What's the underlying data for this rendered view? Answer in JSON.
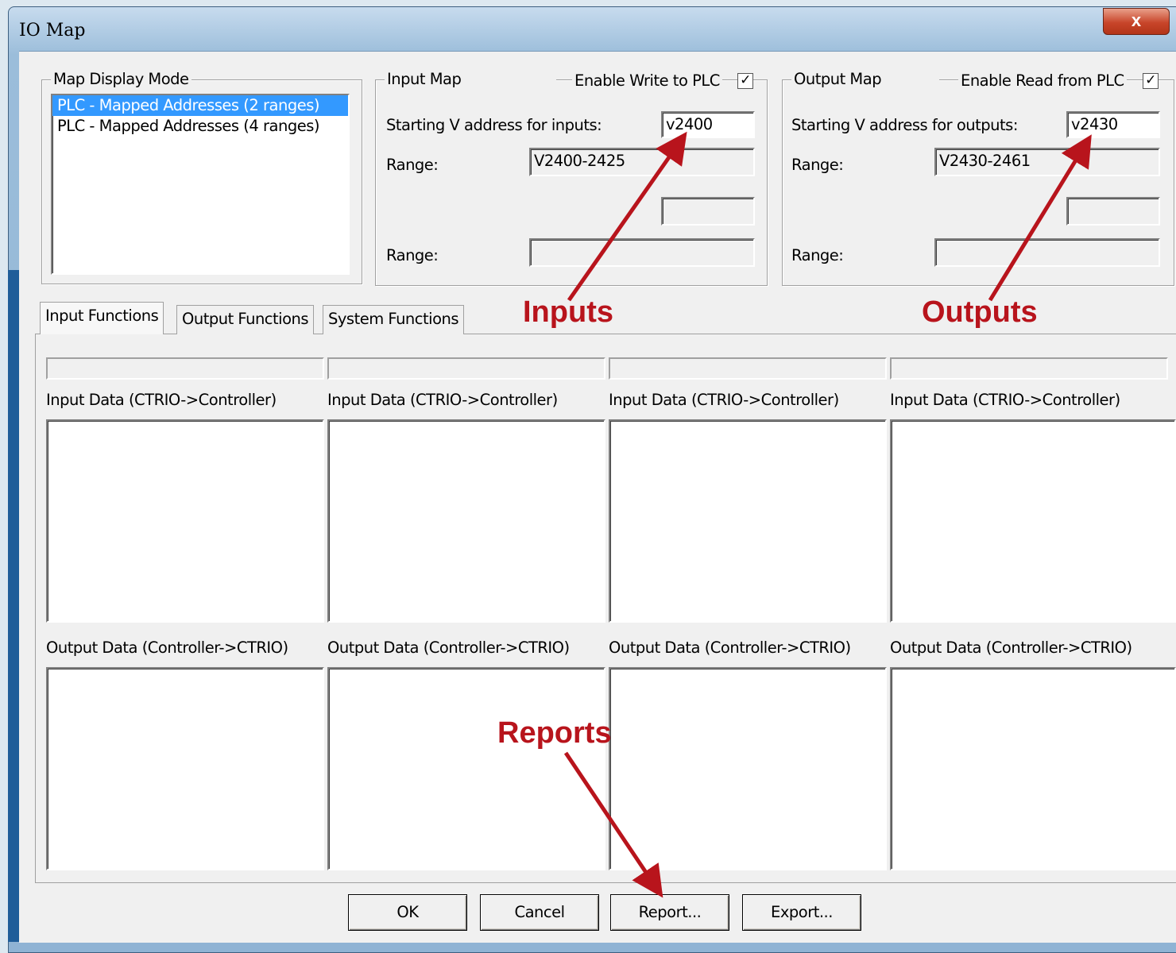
{
  "window": {
    "title": "IO Map",
    "close_glyph": "x"
  },
  "display_mode": {
    "legend": "Map Display Mode",
    "options": [
      "PLC - Mapped Addresses (2 ranges)",
      "PLC - Mapped Addresses (4 ranges)"
    ],
    "selected_index": 0
  },
  "input_map": {
    "legend": "Input Map",
    "enable_label": "Enable Write to PLC",
    "enable_checked": true,
    "start_label": "Starting V address for inputs:",
    "start_value": "v2400",
    "range_label_1": "Range:",
    "range_value_1": "V2400-2425",
    "range_value_2": "",
    "range_label_2": "Range:",
    "range_value_3": ""
  },
  "output_map": {
    "legend": "Output Map",
    "enable_label": "Enable Read from PLC",
    "enable_checked": true,
    "start_label": "Starting V address for outputs:",
    "start_value": "v2430",
    "range_label_1": "Range:",
    "range_value_1": "V2430-2461",
    "range_value_2": "",
    "range_label_2": "Range:",
    "range_value_3": ""
  },
  "tabs": [
    "Input Functions",
    "Output Functions",
    "System Functions"
  ],
  "active_tab": 0,
  "columns": {
    "input_label": "Input Data (CTRIO->Controller)",
    "output_label": "Output Data (Controller->CTRIO)"
  },
  "buttons": {
    "ok": "OK",
    "cancel": "Cancel",
    "report": "Report...",
    "export": "Export..."
  },
  "annotations": {
    "inputs": "Inputs",
    "outputs": "Outputs",
    "reports": "Reports",
    "color": "#b8141c"
  },
  "colors": {
    "selection": "#3399ff",
    "annotation_red": "#b8141c"
  }
}
